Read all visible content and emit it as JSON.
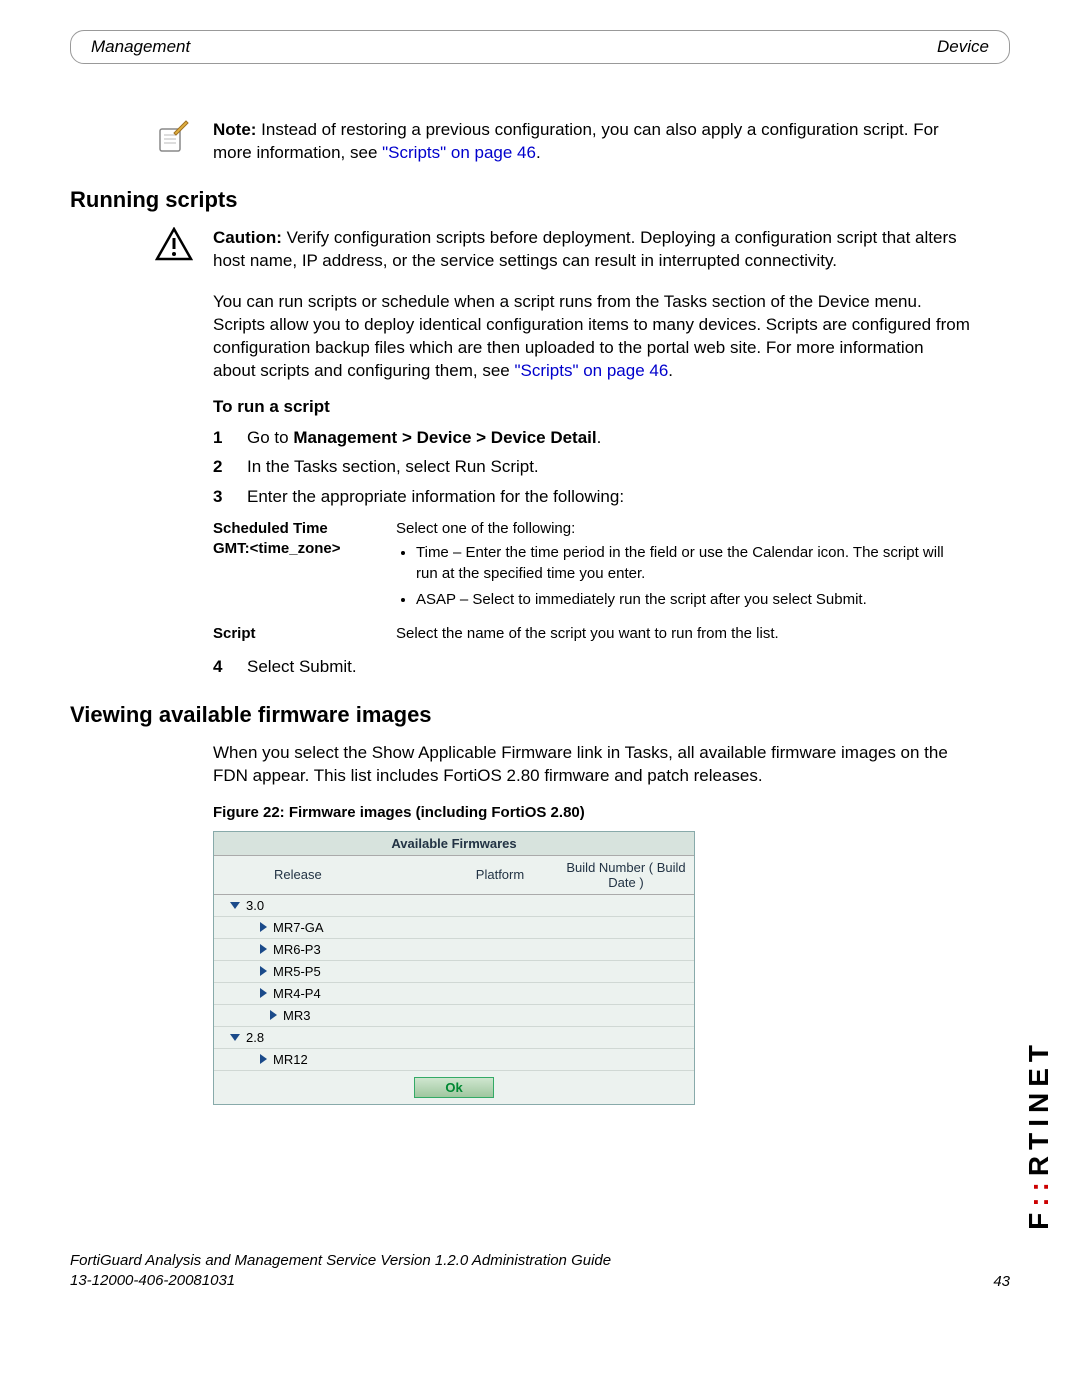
{
  "header": {
    "left": "Management",
    "right": "Device"
  },
  "note": {
    "bold": "Note:",
    "text": " Instead of restoring a previous configuration, you can also apply a configuration script. For more information, see ",
    "link": "\"Scripts\" on page 46",
    "after": "."
  },
  "section1_title": "Running scripts",
  "caution": {
    "bold": "Caution:",
    "text": " Verify configuration scripts before deployment. Deploying a configuration script that alters host name, IP address, or the service settings can result in interrupted connectivity."
  },
  "para1_before": "You can run scripts or schedule when a script runs from the Tasks section of the Device menu. Scripts allow you to deploy identical configuration items to many devices. Scripts are configured from configuration backup files which are then uploaded to the portal web site. For more information about scripts and configuring them, see ",
  "para1_link": "\"Scripts\" on page 46",
  "para1_after": ".",
  "subhead1": "To run a script",
  "step1_before": "Go to ",
  "step1_bold": "Management > Device > Device Detail",
  "step1_after": ".",
  "step2": "In the Tasks section, select Run Script.",
  "step3": "Enter the appropriate information for the following:",
  "field1_label_a": "Scheduled Time",
  "field1_label_b": "GMT:<time_zone>",
  "field1_intro": "Select one of the following:",
  "field1_bullet1": "Time – Enter the time period in the field or use the Calendar icon. The script will run at the specified time you enter.",
  "field1_bullet2": "ASAP – Select to immediately run the script after you select Submit.",
  "field2_label": "Script",
  "field2_text": "Select the name of the script you want to run from the list.",
  "step4": "Select Submit.",
  "section2_title": "Viewing available firmware images",
  "para2": "When you select the Show Applicable Firmware link in Tasks, all available firmware images on the FDN appear. This list includes FortiOS 2.80 firmware and patch releases.",
  "figure_caption": "Figure 22: Firmware images (including FortiOS 2.80)",
  "fw": {
    "title": "Available Firmwares",
    "col_release": "Release",
    "col_platform": "Platform",
    "col_build": "Build Number ( Build Date )",
    "rows": [
      "3.0",
      "MR7-GA",
      "MR6-P3",
      "MR5-P5",
      "MR4-P4",
      "MR3",
      "2.8",
      "MR12"
    ],
    "ok": "Ok"
  },
  "footer": {
    "line1": "FortiGuard Analysis and Management Service Version 1.2.0 Administration Guide",
    "line2": "13-12000-406-20081031",
    "page": "43"
  }
}
